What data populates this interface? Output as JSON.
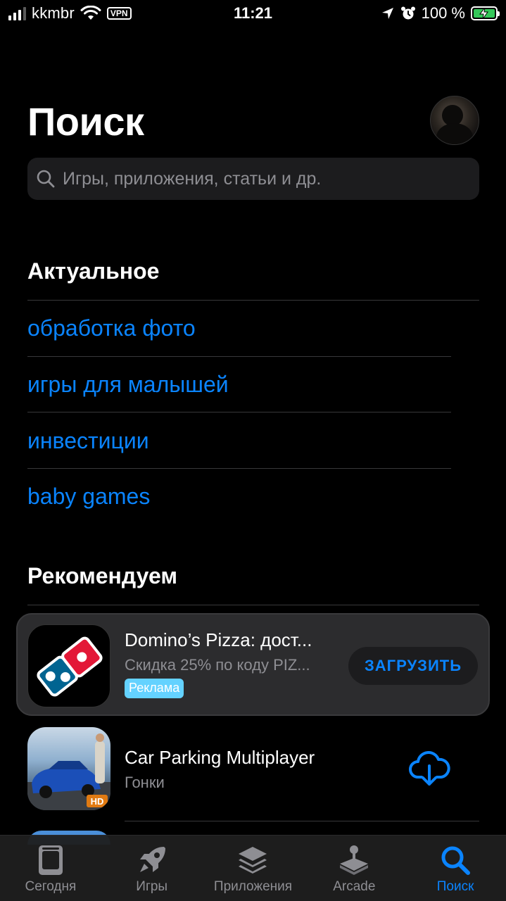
{
  "status_bar": {
    "carrier": "kkmbr",
    "vpn": "VPN",
    "time": "11:21",
    "battery_text": "100 %"
  },
  "header": {
    "title": "Поиск"
  },
  "search": {
    "placeholder": "Игры, приложения, статьи и др."
  },
  "trending": {
    "title": "Актуальное",
    "items": [
      "обработка фото",
      "игры для малышей",
      "инвестиции",
      "baby games"
    ]
  },
  "recommended": {
    "title": "Рекомендуем",
    "apps": [
      {
        "name": "Domino’s Pizza: дост...",
        "subtitle": "Скидка 25% по коду PIZ...",
        "badge": "Реклама",
        "button": "ЗАГРУЗИТЬ"
      },
      {
        "name": "Car Parking Multiplayer",
        "subtitle": "Гонки"
      }
    ]
  },
  "tabs": [
    {
      "label": "Сегодня",
      "icon": "today-icon"
    },
    {
      "label": "Игры",
      "icon": "rocket-icon"
    },
    {
      "label": "Приложения",
      "icon": "layers-icon"
    },
    {
      "label": "Arcade",
      "icon": "joystick-icon"
    },
    {
      "label": "Поиск",
      "icon": "search-icon"
    }
  ],
  "colors": {
    "accent": "#0a84ff",
    "background": "#000000",
    "card": "#2c2c2e",
    "badge": "#64d2ff"
  }
}
